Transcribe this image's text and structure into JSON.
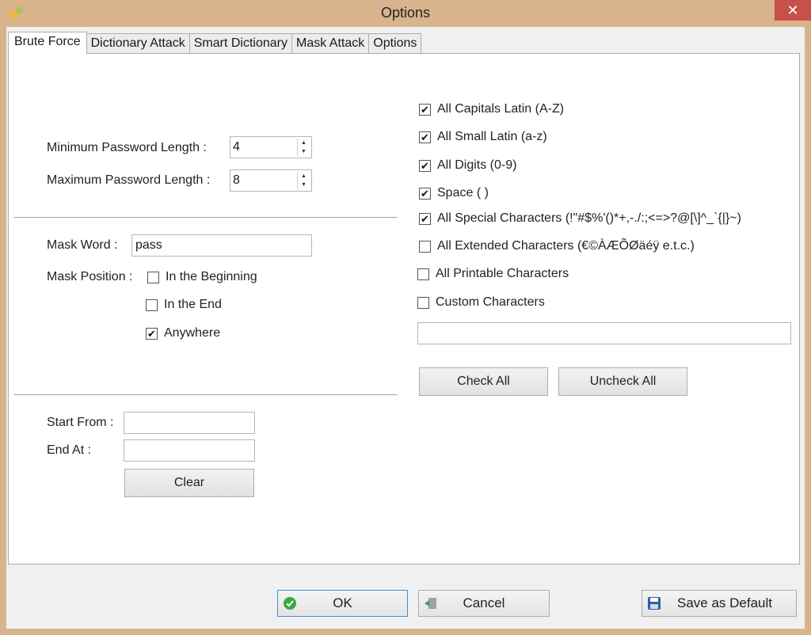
{
  "window": {
    "title": "Options",
    "close_glyph": "✕"
  },
  "tabs": [
    {
      "label": "Brute Force",
      "active": true
    },
    {
      "label": "Dictionary Attack",
      "active": false
    },
    {
      "label": "Smart Dictionary",
      "active": false
    },
    {
      "label": "Mask Attack",
      "active": false
    },
    {
      "label": "Options",
      "active": false
    }
  ],
  "length": {
    "min_label": "Minimum Password Length :",
    "min_value": "4",
    "max_label": "Maximum Password Length :",
    "max_value": "8"
  },
  "mask": {
    "word_label": "Mask Word :",
    "word_value": "pass",
    "position_label": "Mask Position :",
    "options": [
      {
        "label": "In the Beginning",
        "checked": false
      },
      {
        "label": "In the End",
        "checked": false
      },
      {
        "label": "Anywhere",
        "checked": true
      }
    ]
  },
  "range": {
    "start_label": "Start From :",
    "start_value": "",
    "end_label": "End At :",
    "end_value": "",
    "clear_label": "Clear"
  },
  "charsets": [
    {
      "label": "All Capitals Latin (A-Z)",
      "checked": true
    },
    {
      "label": "All Small Latin (a-z)",
      "checked": true
    },
    {
      "label": "All Digits (0-9)",
      "checked": true
    },
    {
      "label": "Space ( )",
      "checked": true
    },
    {
      "label": "All Special Characters (!\"#$%'()*+,-./:;<=>?@[\\]^_`{|}~)",
      "checked": true
    },
    {
      "label": "All Extended Characters (€©ÀÆÕØäéÿ e.t.c.)",
      "checked": false
    },
    {
      "label": "All Printable Characters",
      "checked": false
    },
    {
      "label": "Custom Characters",
      "checked": false
    }
  ],
  "custom_chars_value": "",
  "check_all_label": "Check All",
  "uncheck_all_label": "Uncheck All",
  "footer": {
    "ok_label": "OK",
    "cancel_label": "Cancel",
    "save_default_label": "Save as Default"
  },
  "colors": {
    "frame": "#d9b38c",
    "close": "#c7504a",
    "focus": "#3a8fd8"
  }
}
